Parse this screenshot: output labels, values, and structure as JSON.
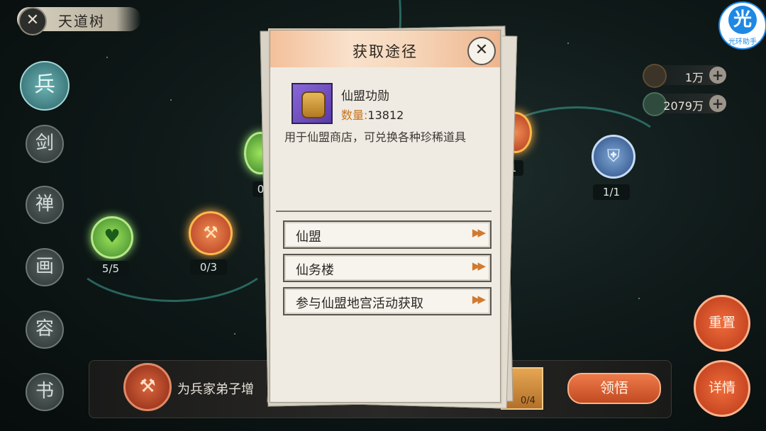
{
  "header": {
    "title": "天道树",
    "close_icon": "close-icon"
  },
  "sidebar": {
    "items": [
      "兵",
      "剑",
      "禅",
      "画",
      "容",
      "书"
    ]
  },
  "nodes": [
    {
      "count": "5/5"
    },
    {
      "count": "0/3"
    },
    {
      "count": "0/"
    },
    {
      "count": "/1"
    },
    {
      "count": "1/1"
    }
  ],
  "resources": [
    {
      "value": "1万"
    },
    {
      "value": "2079万"
    }
  ],
  "helper": {
    "label": "光环助手"
  },
  "right_buttons": {
    "reset": "重置",
    "details": "详情"
  },
  "bottom": {
    "text": "为兵家弟子增",
    "collect": "领悟",
    "item_count": "0/4"
  },
  "modal": {
    "title": "获取途径",
    "item_name": "仙盟功勋",
    "qty_label": "数量:",
    "qty_value": "13812",
    "description": "用于仙盟商店，可兑换各种珍稀道具",
    "sources": [
      "仙盟",
      "仙务楼",
      "参与仙盟地宫活动获取"
    ],
    "arrow": "▶▶"
  },
  "colors": {
    "accent_orange": "#d17a2f",
    "modal_bg": "#efebe3",
    "teal_branch": "#3fa59a"
  }
}
